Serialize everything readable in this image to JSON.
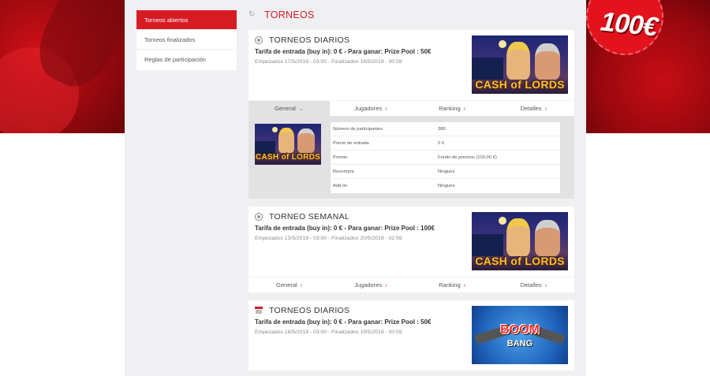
{
  "promo": {
    "amount": "100€"
  },
  "sidebar": {
    "items": [
      {
        "label": "Torneos abiertos",
        "active": true
      },
      {
        "label": "Torneos finalizados",
        "active": false
      },
      {
        "label": "Reglas de participación",
        "active": false
      }
    ]
  },
  "header": {
    "title": "TORNEOS"
  },
  "tournaments": [
    {
      "name": "TORNEOS DIARIOS",
      "fee": "Tarifa de entrada (buy in): 0 € - Para ganar: Prize Pool : 50€",
      "dates": "Empezados 17/5/2019 - 03:00 - Finalizados 18/5/2019 - 00:59",
      "game_logo": "CASH of LORDS",
      "tabs": [
        "General",
        "Jugadores",
        "Ranking",
        "Detalles"
      ],
      "details": [
        {
          "k": "Número de participantes",
          "v": "380"
        },
        {
          "k": "Precio de entrada",
          "v": "0 €"
        },
        {
          "k": "Premio",
          "v": "Fondo de premios (100,00 €)"
        },
        {
          "k": "Recompra",
          "v": "Ninguno"
        },
        {
          "k": "Add on",
          "v": "Ninguno"
        }
      ]
    },
    {
      "name": "TORNEO SEMANAL",
      "fee": "Tarifa de entrada (buy in): 0 € - Para ganar: Prize Pool : 100€",
      "dates": "Empezados 13/5/2019 - 03:00 - Finalizados 20/5/2019 - 02:59",
      "game_logo": "CASH of LORDS",
      "tabs": [
        "General",
        "Jugadores",
        "Ranking",
        "Detalles"
      ]
    },
    {
      "name": "TORNEOS DIARIOS",
      "fee": "Tarifa de entrada (buy in): 0 € - Para ganar: Prize Pool : 50€",
      "dates": "Empezados 18/5/2019 - 03:00 - Finalizados 19/5/2019 - 00:59",
      "game_logo_1": "BOOM",
      "game_logo_2": "BANG"
    }
  ]
}
